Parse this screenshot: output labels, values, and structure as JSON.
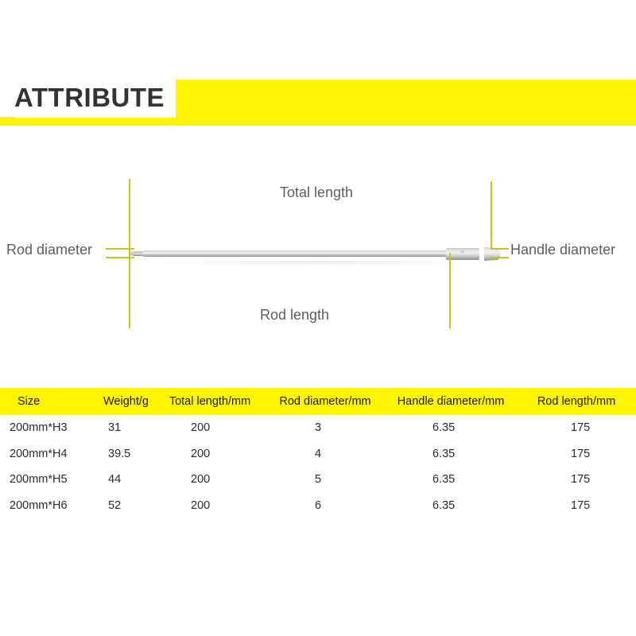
{
  "colors": {
    "brand_yellow": "#fff500",
    "callout_line": "#c6c618",
    "heading_text": "#333333",
    "label_text": "#5d5d5d",
    "table_text": "#2a2a2a"
  },
  "header": {
    "title": "ATTRIBUTE"
  },
  "diagram": {
    "labels": {
      "total_length": "Total length",
      "rod_length": "Rod length",
      "rod_diameter": "Rod diameter",
      "handle_diameter": "Handle diameter"
    },
    "product_marking": "S2"
  },
  "table": {
    "columns": [
      "Size",
      "Weight/g",
      "Total length/mm",
      "Rod diameter/mm",
      "Handle diameter/mm",
      "Rod length/mm"
    ],
    "rows": [
      {
        "size": "200mm*H3",
        "weight": "31",
        "total_length": "200",
        "rod_diameter": "3",
        "handle_diameter": "6.35",
        "rod_length": "175"
      },
      {
        "size": "200mm*H4",
        "weight": "39.5",
        "total_length": "200",
        "rod_diameter": "4",
        "handle_diameter": "6.35",
        "rod_length": "175"
      },
      {
        "size": "200mm*H5",
        "weight": "44",
        "total_length": "200",
        "rod_diameter": "5",
        "handle_diameter": "6.35",
        "rod_length": "175"
      },
      {
        "size": "200mm*H6",
        "weight": "52",
        "total_length": "200",
        "rod_diameter": "6",
        "handle_diameter": "6.35",
        "rod_length": "175"
      }
    ]
  }
}
